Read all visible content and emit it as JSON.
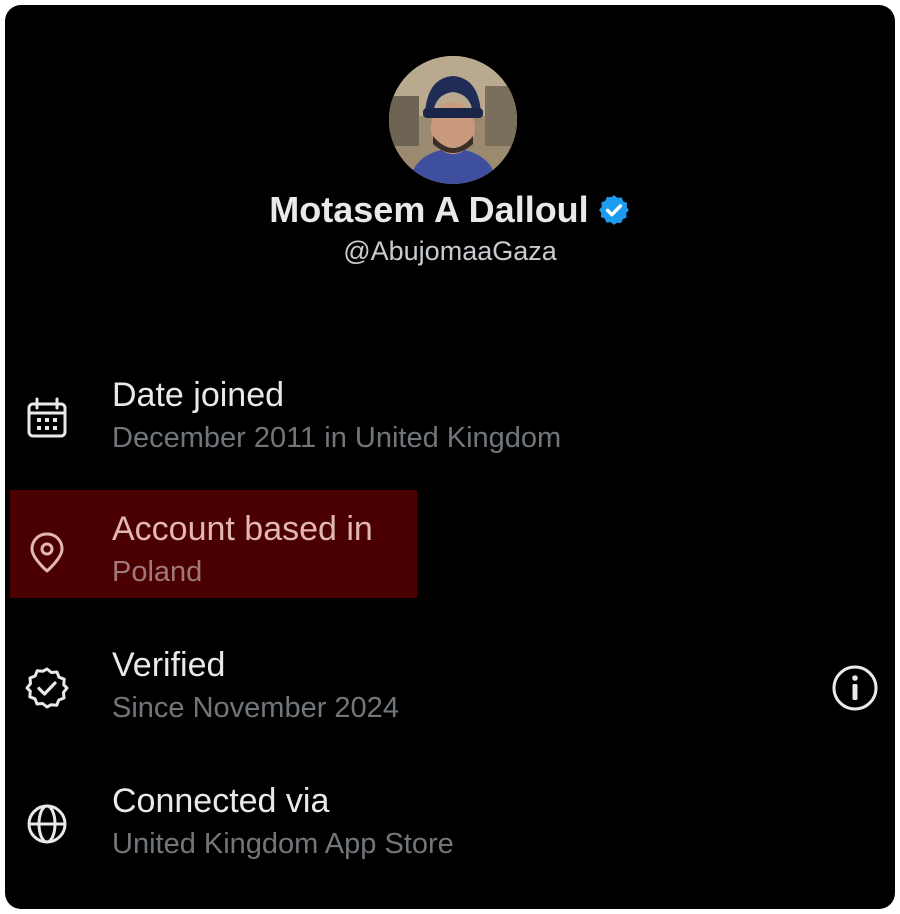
{
  "profile": {
    "name": "Motasem A Dalloul",
    "handle": "@AbujomaaGaza",
    "verified_badge_color": "#1d9bf0"
  },
  "rows": [
    {
      "icon": "calendar-icon",
      "title": "Date joined",
      "value": "December 2011 in United Kingdom"
    },
    {
      "icon": "location-pin-icon",
      "title": "Account based in",
      "value": "Poland",
      "highlighted": true,
      "highlight_color": "#4a0000"
    },
    {
      "icon": "verified-check-icon",
      "title": "Verified",
      "value": "Since November 2024",
      "action_icon": "info-icon"
    },
    {
      "icon": "globe-icon",
      "title": "Connected via",
      "value": "United Kingdom App Store"
    }
  ]
}
